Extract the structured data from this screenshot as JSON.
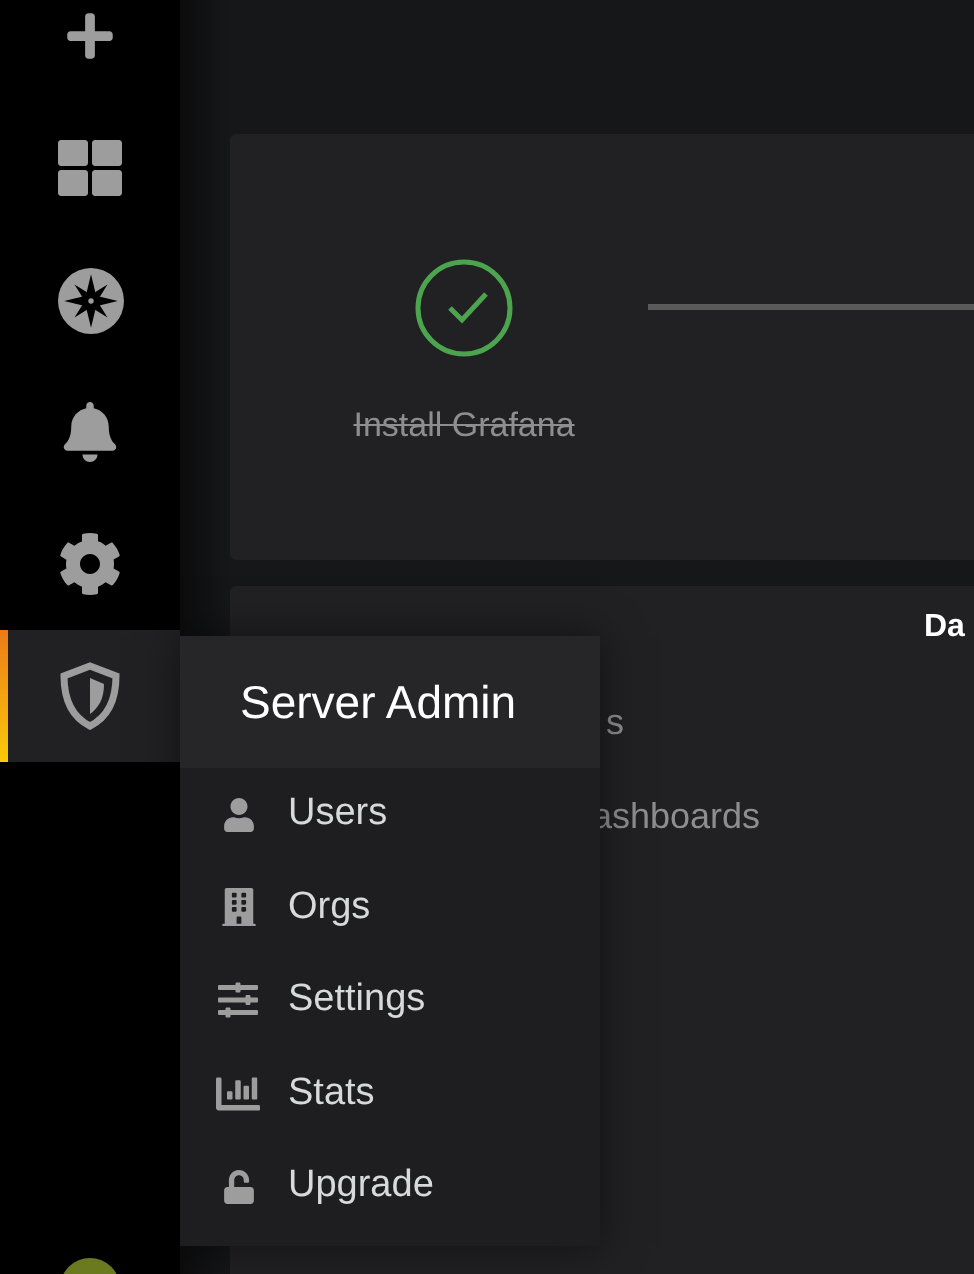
{
  "sidebar": {
    "items": [
      {
        "selected": false
      },
      {
        "selected": false
      },
      {
        "selected": false
      },
      {
        "selected": false
      },
      {
        "selected": false
      },
      {
        "selected": true
      }
    ]
  },
  "menu": {
    "title": "Server Admin",
    "items": [
      {
        "label": "Users"
      },
      {
        "label": "Orgs"
      },
      {
        "label": "Settings"
      },
      {
        "label": "Stats"
      },
      {
        "label": "Upgrade"
      }
    ]
  },
  "steps": [
    {
      "label": "Install Grafana",
      "done": true
    }
  ],
  "panel": {
    "title": "Da",
    "lines": [
      "s",
      "ashboards"
    ]
  }
}
